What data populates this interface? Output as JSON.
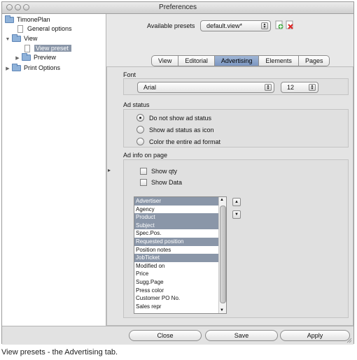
{
  "window": {
    "title": "Preferences"
  },
  "sidebar": {
    "root": "TimonePlan",
    "items": [
      {
        "label": "General options"
      },
      {
        "label": "View"
      },
      {
        "label": "View preset"
      },
      {
        "label": "Preview"
      },
      {
        "label": "Print Options"
      }
    ]
  },
  "presets": {
    "label": "Available presets",
    "value": "default.view*"
  },
  "tabs": [
    "View",
    "Editorial",
    "Advertising",
    "Elements",
    "Pages"
  ],
  "active_tab": "Advertising",
  "font": {
    "label": "Font",
    "family": "Arial",
    "size": "12"
  },
  "ad_status": {
    "label": "Ad status",
    "options": [
      "Do not show ad status",
      "Show ad status as icon",
      "Color the entire ad format"
    ],
    "selected": "Do not show ad status"
  },
  "ad_info": {
    "label": "Ad info on page",
    "show_qty": "Show qty",
    "show_data": "Show Data",
    "list": [
      {
        "text": "Advertiser",
        "selected": true
      },
      {
        "text": "Agency",
        "selected": false
      },
      {
        "text": "Product",
        "selected": true
      },
      {
        "text": "Subject",
        "selected": true
      },
      {
        "text": "Spec.Pos.",
        "selected": false
      },
      {
        "text": "Requested position",
        "selected": true
      },
      {
        "text": "Position notes",
        "selected": false
      },
      {
        "text": "JobTicket",
        "selected": true
      },
      {
        "text": "Modified on",
        "selected": false
      },
      {
        "text": "Price",
        "selected": false
      },
      {
        "text": "Sugg.Page",
        "selected": false
      },
      {
        "text": "Press color",
        "selected": false
      },
      {
        "text": "Customer PO No.",
        "selected": false
      },
      {
        "text": "Sales repr",
        "selected": false
      }
    ]
  },
  "buttons": {
    "close": "Close",
    "save": "Save",
    "apply": "Apply"
  },
  "caption": "View presets - the Advertising tab.",
  "colors": {
    "selection": "#8a96a8",
    "active_tab": "#8aa3cb"
  }
}
